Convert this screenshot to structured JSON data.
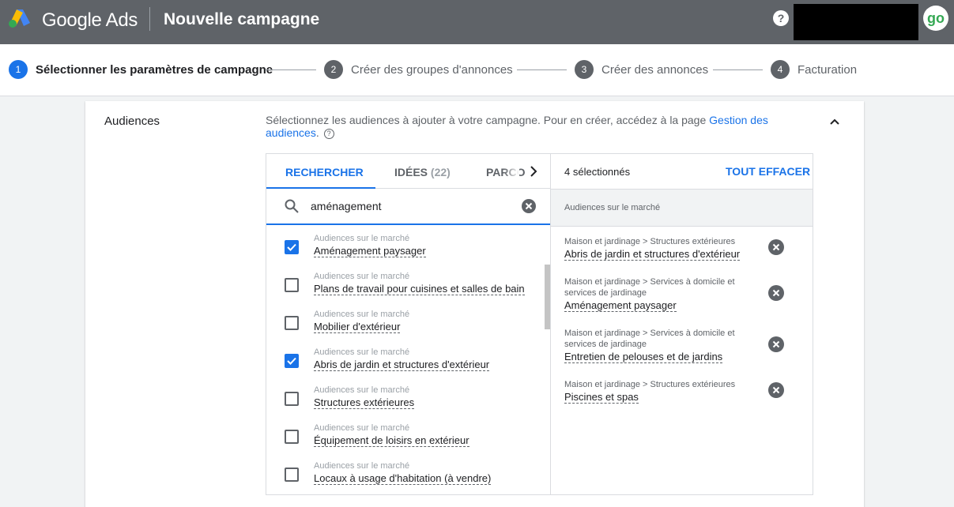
{
  "header": {
    "brand": "Google Ads",
    "page_title": "Nouvelle campagne",
    "help_label": "?",
    "avatar_text": "go",
    "colors": {
      "bar": "#5f6368",
      "logo_blue": "#4285f4",
      "logo_yellow": "#fbbc04",
      "logo_green": "#34a853"
    }
  },
  "stepper": {
    "steps": [
      {
        "num": "1",
        "label": "Sélectionner les paramètres de campagne",
        "active": true
      },
      {
        "num": "2",
        "label": "Créer des groupes d'annonces",
        "active": false
      },
      {
        "num": "3",
        "label": "Créer des annonces",
        "active": false
      },
      {
        "num": "4",
        "label": "Facturation",
        "active": false
      }
    ]
  },
  "audiences": {
    "title": "Audiences",
    "description": "Sélectionnez les audiences à ajouter à votre campagne. Pour en créer, accédez à la page ",
    "link": "Gestion des audiences",
    "description_end": ".",
    "tabs": {
      "search": "RECHERCHER",
      "ideas": "IDÉES",
      "ideas_count": "(22)",
      "browse": "PARCO"
    },
    "search": {
      "value": "aménagement",
      "placeholder": ""
    },
    "results": [
      {
        "category": "Audiences sur le marché",
        "name": "Aménagement paysager",
        "checked": true
      },
      {
        "category": "Audiences sur le marché",
        "name": "Plans de travail pour cuisines et salles de bain",
        "checked": false
      },
      {
        "category": "Audiences sur le marché",
        "name": "Mobilier d'extérieur",
        "checked": false
      },
      {
        "category": "Audiences sur le marché",
        "name": "Abris de jardin et structures d'extérieur",
        "checked": true
      },
      {
        "category": "Audiences sur le marché",
        "name": "Structures extérieures",
        "checked": false
      },
      {
        "category": "Audiences sur le marché",
        "name": "Équipement de loisirs en extérieur",
        "checked": false
      },
      {
        "category": "Audiences sur le marché",
        "name": "Locaux à usage d'habitation (à vendre)",
        "checked": false
      }
    ],
    "selected_count": "4 sélectionnés",
    "clear_all": "TOUT EFFACER",
    "group_label": "Audiences sur le marché",
    "selected": [
      {
        "path": "Maison et jardinage > Structures extérieures",
        "name": "Abris de jardin et structures d'extérieur"
      },
      {
        "path": "Maison et jardinage > Services à domicile et services de jardinage",
        "name": "Aménagement paysager"
      },
      {
        "path": "Maison et jardinage > Services à domicile et services de jardinage",
        "name": "Entretien de pelouses et de jardins"
      },
      {
        "path": "Maison et jardinage > Structures extérieures",
        "name": "Piscines et spas"
      }
    ]
  }
}
